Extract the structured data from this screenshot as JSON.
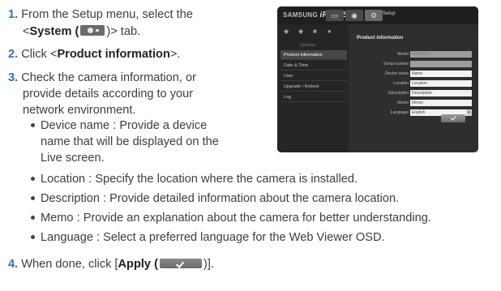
{
  "steps": {
    "s1": {
      "num": "1.",
      "a": "From the Setup menu, select the",
      "b_pre": "<",
      "b_bold": "System (",
      "b_post": ")> tab."
    },
    "s2": {
      "num": "2.",
      "pre": "Click <",
      "bold": "Product information",
      "post": ">."
    },
    "s3": {
      "num": "3.",
      "a": "Check the camera information, or",
      "b": "provide details according to your",
      "c": "network environment."
    },
    "s4": {
      "num": "4.",
      "pre": "When done, click [",
      "bold": "Apply (",
      "post": ")]."
    }
  },
  "bullets": {
    "device_name_1": "Device name : Provide a device",
    "device_name_2": "name that will be displayed on the",
    "device_name_3": "Live screen.",
    "location": "Location : Specify the location where the camera is installed.",
    "description": "Description : Provide detailed information about the camera location.",
    "memo": "Memo : Provide an explanation about the camera for better understanding.",
    "language": "Language : Select a preferred language for the Web Viewer OSD."
  },
  "icons": {
    "system_tab": "gear-icon",
    "apply": "check-icon"
  },
  "ui": {
    "logo_brand": "SAMSUNG",
    "logo_product": "iPOLiS",
    "setup_label": "Setup",
    "dynamic_label": "Dynamic",
    "menu": [
      "Product information",
      "Date & Time",
      "User",
      "Upgrade / Reboot",
      "Log"
    ],
    "form_title": "Product information",
    "fields": [
      {
        "label": "Model",
        "value": "SND-5061"
      },
      {
        "label": "Serial number",
        "value": ""
      },
      {
        "label": "Device name",
        "value": "Name"
      },
      {
        "label": "Location",
        "value": "Location"
      },
      {
        "label": "Description",
        "value": "Description"
      },
      {
        "label": "Memo",
        "value": "Memo"
      },
      {
        "label": "Language",
        "value": "English"
      }
    ],
    "colors": {
      "panel": "#2e2e2e",
      "topbar": "#1f1f1f",
      "selected": "#474747"
    }
  }
}
